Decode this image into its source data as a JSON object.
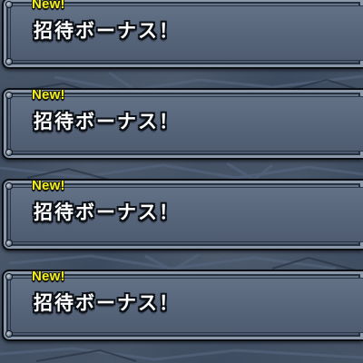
{
  "messages": [
    {
      "badge": "New!",
      "title": "招待ボーナス！"
    },
    {
      "badge": "New!",
      "title": "招待ボーナス！"
    },
    {
      "badge": "New!",
      "title": "招待ボーナス！"
    },
    {
      "badge": "New!",
      "title": "招待ボーナス！"
    }
  ],
  "colors": {
    "background": "#3c4a5f",
    "panel": "#56647a",
    "panel_border": "#0a0d12",
    "badge": "#f2ef1e",
    "title": "#ffffff"
  }
}
